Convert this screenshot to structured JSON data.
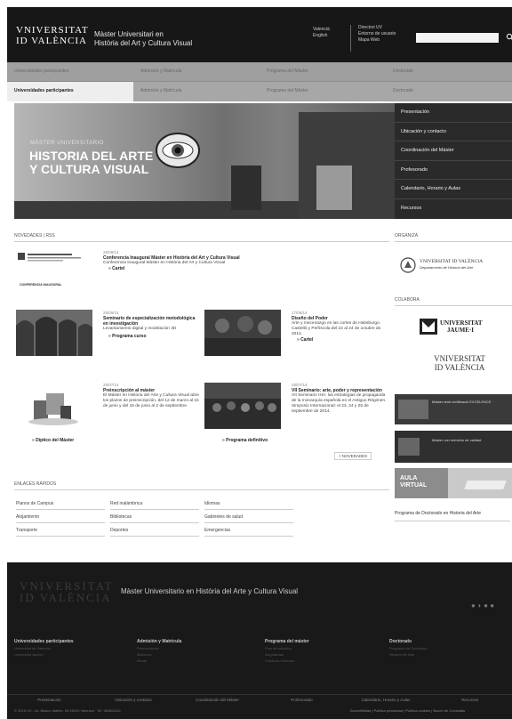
{
  "header": {
    "logo_line1": "VNIVERSITAT",
    "logo_line2": "ID VALÈNCIA",
    "title_line1": "Màster Universitari en",
    "title_line2": "Història del Art y Cultura Visual",
    "lang1": "Valencià",
    "lang2": "English",
    "link1": "Directori UV",
    "link2": "Entorno de usuario",
    "link3": "Mapa Web",
    "search_placeholder": ""
  },
  "nav": {
    "row1": [
      "Universidades participantes",
      "Admisión y Matrícula",
      "Programa del Máster",
      "Doctorado"
    ],
    "row2": [
      "Universidades participantes",
      "Admisión y Matrícula",
      "Programa del Máster",
      "Doctorado"
    ]
  },
  "hero": {
    "subtitle": "MÀSTER UNIVERSITARIO",
    "title1": "HISTORIA DEL ARTE",
    "title2": "Y CULTURA VISUAL"
  },
  "side_menu": [
    "Presentación",
    "Ubicación y contacto",
    "Coordinación del Máster",
    "Profesorado",
    "Calendario, Horario y Aulas",
    "Recursos"
  ],
  "news": {
    "header": "NOVEDADES  |  RSS",
    "items": [
      {
        "date": "25/09/14",
        "title": "Conferencia Inaugural Màster en Història del Art y Cultura Visual",
        "body": "Conferencia Inaugural Màster en Història del Art y Cultura Visual",
        "link": "Cartel"
      },
      {
        "date": "25/09/14",
        "title": "Seminario de especialización metodológica en investigación",
        "body": "Levantamiento digital y modelación 3D",
        "link": "Programa curso"
      },
      {
        "date": "17/09/14",
        "title": "Diseño del Poder",
        "body": "Arte y mecenazgo en las cortes de Habsburgo. Castelló y Peñíscola del 22 al 24 de octubre de 2014.",
        "link": "Cartel"
      },
      {
        "date": "25/07/14",
        "title": "Preinscripción al máster",
        "body": "El Máster en Historia del Arte y Cultura Visual abre los plazos de preinscripción, del 12 de marzo al 15 de junio y del 16 de junio al 2 de septiembre.",
        "link": "Díptico del Máster"
      },
      {
        "date": "28/07/14",
        "title": "VII Seminario: arte, poder y representación",
        "body": "VII Seminario IHA: las estrategias de propaganda de la monarquía española en el Antiguo Régimen. Simposio Internacional: el 23, 24 y 25 de septiembre de 2014.",
        "link": "Programa definitivo"
      }
    ],
    "thumb_caption": "CONFERENCIA INAUGURAL",
    "more": "+ NOVEDADES"
  },
  "quick": {
    "header": "ENLACES RÁPIDOS",
    "col1": [
      "Planos de Campus",
      "Alojamiento",
      "Transporte"
    ],
    "col2": [
      "Red inalámbrica",
      "Bibliotecas",
      "Deportes"
    ],
    "col3": [
      "Idiomas",
      "Gabinetes de salud",
      "Emergencias"
    ]
  },
  "right": {
    "organiza": "ORGANIZA",
    "organiza_logo1": "VNIVERSITAT  ID VALÈNCIA",
    "organiza_logo2": "Departamento de Historia del Arte",
    "colabora": "COLABORA",
    "jaume1": "UNIVERSITAT",
    "jaume2": "JAUME·I",
    "uv1": "VNIVERSITAT",
    "uv2": "ID VALÈNCIA",
    "banner1": "Màster amb certificació EXCELENCE",
    "banner2": "Máster con mención de calidad",
    "aula1": "AULA",
    "aula2": "VIRTUAL",
    "doctorado": "Programa de Doctorado en Historia del Arte"
  },
  "footer": {
    "logo1": "VNIVERSITAT",
    "logo2": "ID VALÈNCIA",
    "title": "Màster Universitario en Història del Arte y Cultura Visual",
    "cols": [
      {
        "h": "Universidades participantes",
        "s": [
          "Universitat de València",
          "Universitat Jaume I"
        ]
      },
      {
        "h": "Admisión y Matrícula",
        "s": [
          "Preinscripción",
          "Matrícula",
          "Becas"
        ]
      },
      {
        "h": "Programa del máster",
        "s": [
          "Plan de estudios",
          "Asignaturas",
          "Prácticas externas"
        ]
      },
      {
        "h": "Doctorado",
        "s": [
          "Programa de Doctorado",
          "Historia del Arte"
        ]
      }
    ],
    "nav": [
      "Presentación",
      "Ubicación y contacto",
      "Coordinación del Máster",
      "Profesorado",
      "Calendario, Horario y Aulas",
      "Recursos"
    ],
    "address": "© 2015 UV - Av. Blasco Ibáñez, 28 46010 Valencia · Tel. 963864111",
    "legal": "Accesibilidad | Política privacidad | Política cookies | Buzón de Consultas"
  }
}
